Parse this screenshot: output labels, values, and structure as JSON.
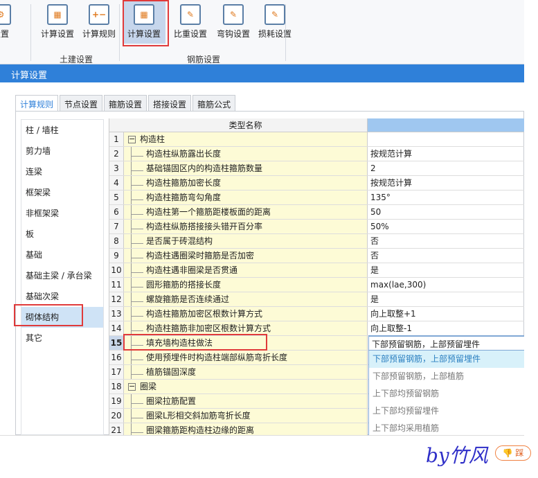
{
  "ribbon": {
    "buttons": [
      {
        "label": "设置",
        "icon": "gear-icon"
      },
      {
        "label": "计算设置",
        "icon": "calc-settings-icon"
      },
      {
        "label": "计算规则",
        "icon": "calc-rules-icon"
      },
      {
        "label": "计算设置",
        "icon": "rebar-calc-settings-icon",
        "selected": true
      },
      {
        "label": "比重设置",
        "icon": "density-settings-icon"
      },
      {
        "label": "弯钩设置",
        "icon": "hook-settings-icon"
      },
      {
        "label": "损耗设置",
        "icon": "loss-settings-icon"
      }
    ],
    "groups": [
      "土建设置",
      "钢筋设置"
    ]
  },
  "window_title": "计算设置",
  "tabs": [
    "计算规则",
    "节点设置",
    "箍筋设置",
    "搭接设置",
    "箍筋公式"
  ],
  "active_tab": 0,
  "sidebar": [
    "柱 / 墙柱",
    "剪力墙",
    "连梁",
    "框架梁",
    "非框架梁",
    "板",
    "基础",
    "基础主梁 / 承台梁",
    "基础次梁",
    "砌体结构",
    "其它"
  ],
  "sidebar_selected": 9,
  "grid": {
    "header": "类型名称",
    "rows": [
      {
        "n": "1",
        "name": "构造柱",
        "value": "",
        "group": true
      },
      {
        "n": "2",
        "name": "构造柱纵筋露出长度",
        "value": "按规范计算"
      },
      {
        "n": "3",
        "name": "基础锚固区内的构造柱箍筋数量",
        "value": "2"
      },
      {
        "n": "4",
        "name": "构造柱箍筋加密长度",
        "value": "按规范计算"
      },
      {
        "n": "5",
        "name": "构造柱箍筋弯勾角度",
        "value": "135°"
      },
      {
        "n": "6",
        "name": "构造柱第一个箍筋距楼板面的距离",
        "value": "50"
      },
      {
        "n": "7",
        "name": "构造柱纵筋搭接接头错开百分率",
        "value": "50%"
      },
      {
        "n": "8",
        "name": "是否属于砖混结构",
        "value": "否"
      },
      {
        "n": "9",
        "name": "构造柱遇圈梁时箍筋是否加密",
        "value": "否"
      },
      {
        "n": "10",
        "name": "构造柱遇非圈梁是否贯通",
        "value": "是"
      },
      {
        "n": "11",
        "name": "圆形箍筋的搭接长度",
        "value": "max(lae,300)"
      },
      {
        "n": "12",
        "name": "螺旋箍筋是否连续通过",
        "value": "是"
      },
      {
        "n": "13",
        "name": "构造柱箍筋加密区根数计算方式",
        "value": "向上取整+1"
      },
      {
        "n": "14",
        "name": "构造柱箍筋非加密区根数计算方式",
        "value": "向上取整-1"
      },
      {
        "n": "15",
        "name": "填充墙构造柱做法",
        "value": "下部预留钢筋，上部预留埋件",
        "current": true
      },
      {
        "n": "16",
        "name": "使用预埋件时构造柱端部纵筋弯折长度",
        "value": ""
      },
      {
        "n": "17",
        "name": "植筋锚固深度",
        "value": ""
      },
      {
        "n": "18",
        "name": "圈梁",
        "value": "",
        "group": true
      },
      {
        "n": "19",
        "name": "圈梁拉筋配置",
        "value": ""
      },
      {
        "n": "20",
        "name": "圈梁L形相交斜加筋弯折长度",
        "value": ""
      },
      {
        "n": "21",
        "name": "圈梁箍筋距构造柱边缘的距离",
        "value": ""
      }
    ]
  },
  "dropdown": {
    "current": "下部预留钢筋，上部预留埋件",
    "options": [
      "下部预留钢筋，上部预留埋件",
      "下部预留钢筋，上部植筋",
      "上下部均预留钢筋",
      "上下部均预留埋件",
      "上下部均采用植筋"
    ],
    "highlighted": 0
  },
  "watermark": "by竹风",
  "dislike_label": "踩",
  "colors": {
    "accent": "#2f80d9",
    "highlight_box": "#e03a3a",
    "name_bg": "#fdfbd6"
  }
}
